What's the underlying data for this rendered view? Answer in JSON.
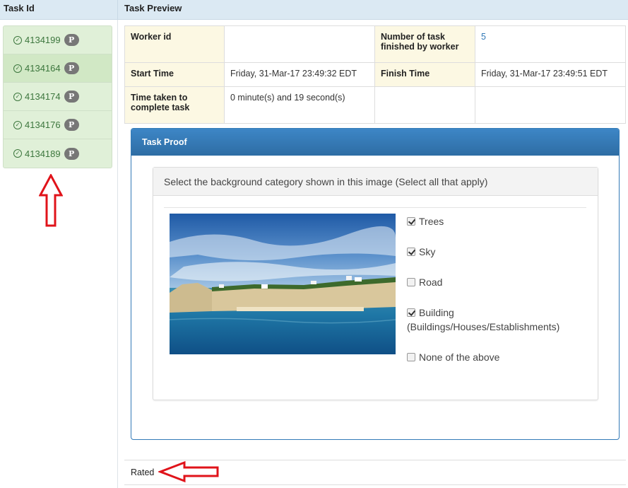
{
  "header": {
    "left_title": "Task Id",
    "right_title": "Task Preview"
  },
  "tasks": [
    {
      "id": "4134199",
      "badge": "P"
    },
    {
      "id": "4134164",
      "badge": "P"
    },
    {
      "id": "4134174",
      "badge": "P"
    },
    {
      "id": "4134176",
      "badge": "P"
    },
    {
      "id": "4134189",
      "badge": "P"
    }
  ],
  "info": {
    "worker_id_label": "Worker id",
    "worker_id_value": "",
    "num_tasks_label": "Number of task finished by worker",
    "num_tasks_value": "5",
    "start_label": "Start Time",
    "start_value": "Friday, 31-Mar-17 23:49:32 EDT",
    "finish_label": "Finish Time",
    "finish_value": "Friday, 31-Mar-17 23:49:51 EDT",
    "duration_label": "Time taken to complete task",
    "duration_value": "0 minute(s) and 19 second(s)"
  },
  "proof": {
    "title": "Task Proof",
    "question": "Select the background category shown in this image (Select all that apply)",
    "options": [
      {
        "label": "Trees",
        "checked": true
      },
      {
        "label": "Sky",
        "checked": true
      },
      {
        "label": "Road",
        "checked": false
      },
      {
        "label": "Building (Buildings/Houses/Establishments)",
        "checked": true
      },
      {
        "label": "None of the above",
        "checked": false
      }
    ]
  },
  "footer": {
    "status": "Rated"
  },
  "colors": {
    "header_bg": "#dbe9f3",
    "task_green": "#3c763d",
    "panel_blue": "#337ab7",
    "arrow_red": "#e0131a"
  }
}
